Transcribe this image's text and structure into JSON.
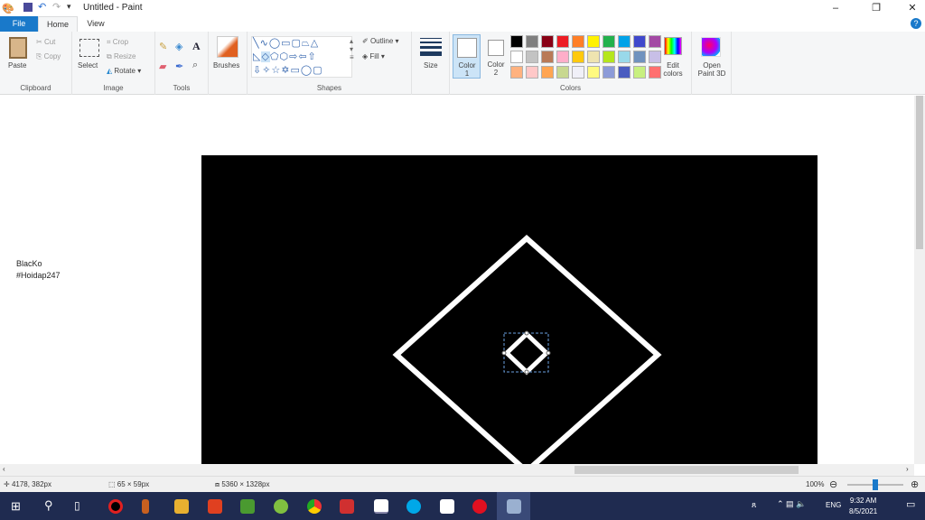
{
  "window": {
    "title": "Untitled - Paint",
    "minimize": "–",
    "restore": "❐",
    "close": "✕",
    "help": "?"
  },
  "tabs": [
    {
      "label": "File"
    },
    {
      "label": "Home"
    },
    {
      "label": "View"
    }
  ],
  "clipboard": {
    "paste": "Paste",
    "cut": "Cut",
    "copy": "Copy",
    "group": "Clipboard"
  },
  "image": {
    "select": "Select",
    "crop": "Crop",
    "resize": "Resize",
    "rotate": "Rotate",
    "group": "Image"
  },
  "tools": {
    "group": "Tools"
  },
  "brushes": {
    "label": "Brushes"
  },
  "shapes": {
    "outline": "Outline",
    "fill": "Fill",
    "group": "Shapes"
  },
  "size": {
    "label": "Size"
  },
  "colors": {
    "color1": "Color",
    "color1_num": "1",
    "color2": "Color",
    "color2_num": "2",
    "edit": "Edit",
    "edit2": "colors",
    "group": "Colors",
    "palette": [
      "#000000",
      "#7f7f7f",
      "#880015",
      "#ed1c24",
      "#ff7f27",
      "#fff200",
      "#22b14c",
      "#00a2e8",
      "#3f48cc",
      "#a349a4",
      "#ffffff",
      "#c3c3c3",
      "#b97a57",
      "#ffaec9",
      "#ffc90e",
      "#efe4b0",
      "#b5e61d",
      "#99d9ea",
      "#7092be",
      "#c8bfe7",
      "#ffb27f",
      "#ffc8c8",
      "#ffa552",
      "#c8d890",
      "#f0f0f8",
      "#fffa80",
      "#8c9bd8",
      "#4a5cc0",
      "#c8f080",
      "#ff7070"
    ],
    "color1_value": "#ffffff",
    "color2_value": "#ffffff"
  },
  "paint3d": {
    "line1": "Open",
    "line2": "Paint 3D"
  },
  "canvas_note": {
    "line1": "BlacKo",
    "line2": "#Hoidap247"
  },
  "status": {
    "cursor": "4178, 382px",
    "selection": "65 × 59px",
    "size": "5360 × 1328px",
    "zoom": "100%",
    "zoom_fraction": 0.5
  },
  "taskbar": {
    "lang": "ENG",
    "time": "9:32 AM",
    "date": "8/5/2021"
  }
}
